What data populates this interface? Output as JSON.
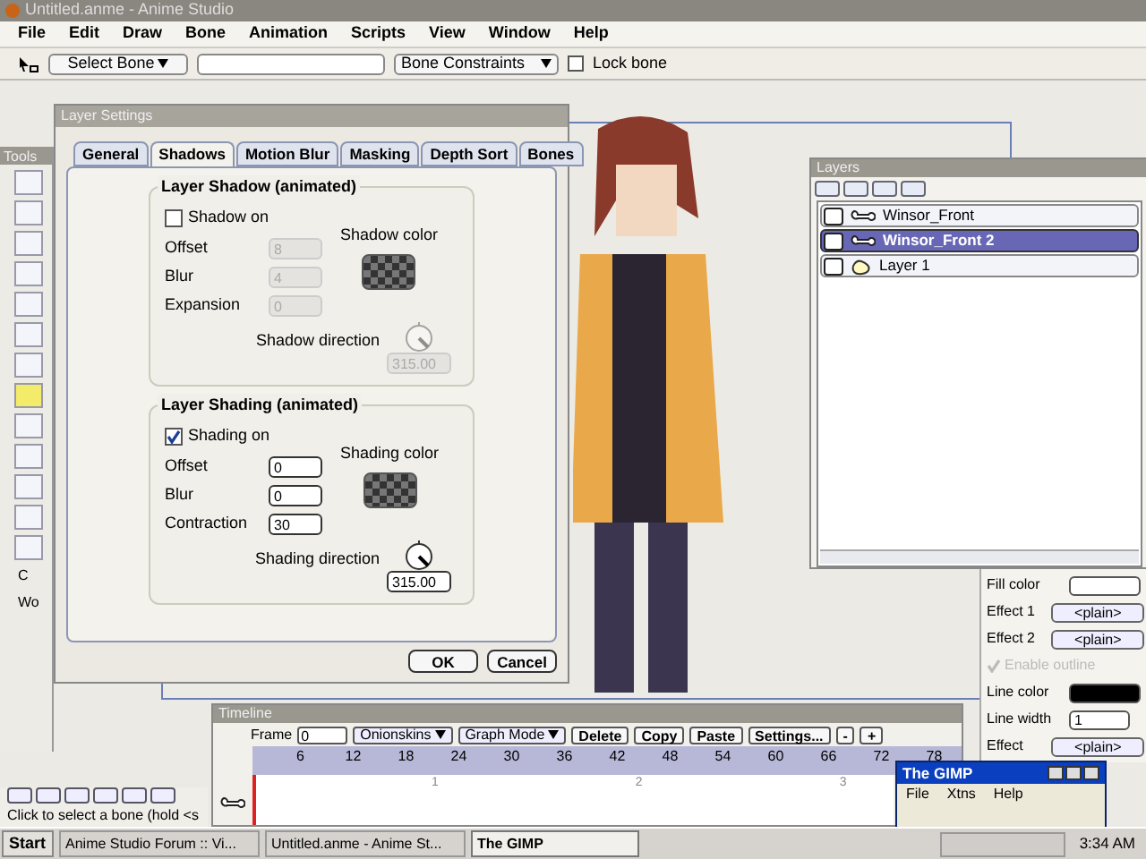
{
  "app_window": {
    "title": "Untitled.anme - Anime Studio",
    "menu": [
      "File",
      "Edit",
      "Draw",
      "Bone",
      "Animation",
      "Scripts",
      "View",
      "Window",
      "Help"
    ],
    "toolbar": {
      "bone_select": "Select Bone",
      "constraints": "Bone Constraints",
      "lock_bone": {
        "label": "Lock bone",
        "checked": false
      }
    }
  },
  "tools_panel": {
    "title": "Tools",
    "labels": [
      "C",
      "Wo"
    ]
  },
  "layer_settings": {
    "title": "Layer Settings",
    "tabs": [
      {
        "label": "General",
        "selected": false
      },
      {
        "label": "Shadows",
        "selected": true
      },
      {
        "label": "Motion Blur",
        "selected": false
      },
      {
        "label": "Masking",
        "selected": false
      },
      {
        "label": "Depth Sort",
        "selected": false
      },
      {
        "label": "Bones",
        "selected": false
      }
    ],
    "groups": [
      {
        "title": "Layer Shadow (animated)",
        "enable": {
          "label": "Shadow on",
          "checked": false
        },
        "fields": [
          {
            "label": "Offset",
            "value": "8"
          },
          {
            "label": "Blur",
            "value": "4"
          },
          {
            "label": "Expansion",
            "value": "0"
          }
        ],
        "color_label": "Shadow color",
        "direction_label": "Shadow direction",
        "direction": "315.00"
      },
      {
        "title": "Layer Shading (animated)",
        "enable": {
          "label": "Shading on",
          "checked": true
        },
        "fields": [
          {
            "label": "Offset",
            "value": "0"
          },
          {
            "label": "Blur",
            "value": "0"
          },
          {
            "label": "Contraction",
            "value": "30"
          }
        ],
        "color_label": "Shading color",
        "direction_label": "Shading direction",
        "direction": "315.00"
      }
    ],
    "buttons": [
      "OK",
      "Cancel"
    ]
  },
  "layers_panel": {
    "title": "Layers",
    "layers": [
      {
        "name": "Winsor_Front",
        "kind": "bone",
        "selected": false
      },
      {
        "name": "Winsor_Front 2",
        "kind": "bone",
        "selected": true
      },
      {
        "name": "Layer 1",
        "kind": "vector",
        "selected": false
      }
    ]
  },
  "style_panel": {
    "rows": [
      {
        "kind": "swatch",
        "label": "Fill color",
        "color": "#ffffff"
      },
      {
        "kind": "dropdown",
        "label": "Effect 1",
        "value": "<plain>"
      },
      {
        "kind": "dropdown",
        "label": "Effect 2",
        "value": "<plain>"
      },
      {
        "kind": "check",
        "label": "Enable outline",
        "checked": true,
        "disabled": true
      },
      {
        "kind": "swatch",
        "label": "Line color",
        "color": "#000000"
      },
      {
        "kind": "field",
        "label": "Line width",
        "value": "1"
      },
      {
        "kind": "dropdown",
        "label": "Effect",
        "value": "<plain>"
      }
    ]
  },
  "timeline": {
    "title": "Timeline",
    "frame_label": "Frame",
    "frame": "0",
    "dropdowns": [
      "Onionskins",
      "Graph Mode"
    ],
    "buttons": [
      "Delete",
      "Copy",
      "Paste",
      "Settings...",
      "-",
      "+"
    ],
    "ruler": [
      "6",
      "12",
      "18",
      "24",
      "30",
      "36",
      "42",
      "48",
      "54",
      "60",
      "66",
      "72",
      "78"
    ],
    "row_marks": [
      "1",
      "2",
      "3"
    ]
  },
  "status": {
    "text": "Click to select a bone (hold <s"
  },
  "gimp": {
    "title": "The GIMP",
    "menu": [
      "File",
      "Xtns",
      "Help"
    ]
  },
  "taskbar": {
    "start": "Start",
    "tasks": [
      {
        "label": "Anime Studio Forum :: Vi...",
        "selected": false
      },
      {
        "label": "Untitled.anme - Anime St...",
        "selected": false
      },
      {
        "label": "The GIMP",
        "selected": true
      }
    ],
    "clock": "3:34 AM"
  }
}
